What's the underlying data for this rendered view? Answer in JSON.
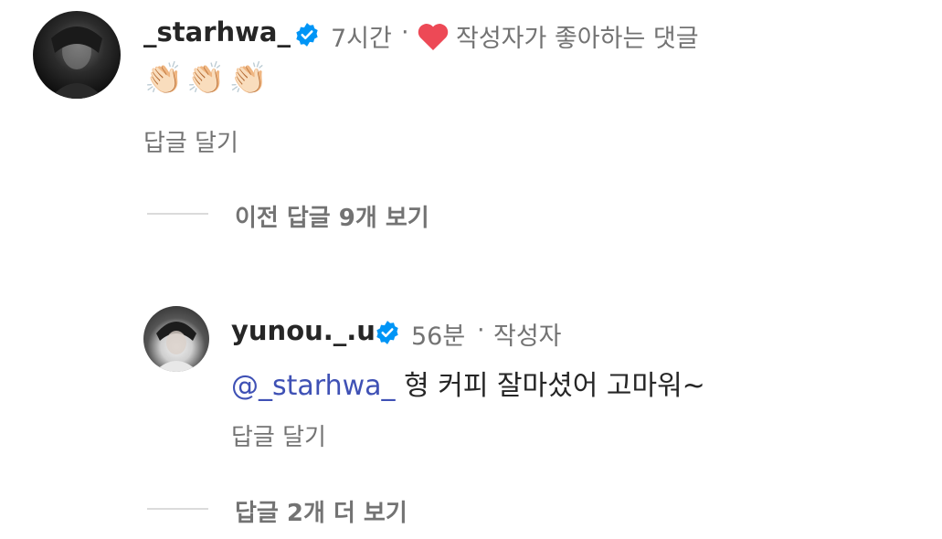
{
  "comment": {
    "username": "_starhwa_",
    "time": "7시간",
    "separator": "·",
    "liked_by_author": "작성자가 좋아하는 댓글",
    "text": "👏🏻👏🏻👏🏻",
    "reply_label": "답글 달기"
  },
  "view_previous_replies": "이전 답글 9개 보기",
  "reply": {
    "username": "yunou._.u",
    "time": "56분",
    "separator": "·",
    "author_tag": "작성자",
    "mention": "@_starhwa_",
    "text": "형 커피 잘마셨어 고마워~",
    "reply_label": "답글 달기"
  },
  "view_more_replies": "답글 2개 더 보기",
  "colors": {
    "verified": "#0095f6",
    "heart": "#ed4956",
    "mention": "#3f51b5",
    "secondary_text": "#737373"
  }
}
